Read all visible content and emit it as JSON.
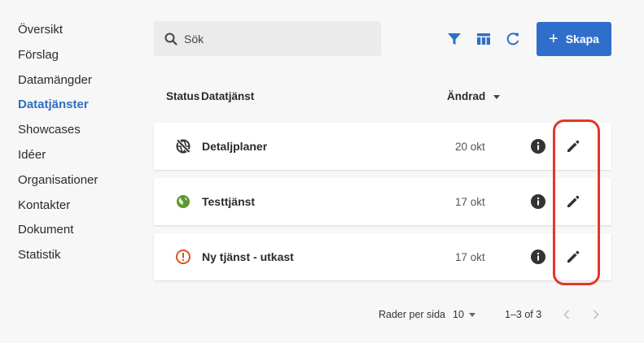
{
  "sidebar": {
    "items": [
      {
        "label": "Översikt"
      },
      {
        "label": "Förslag"
      },
      {
        "label": "Datamängder"
      },
      {
        "label": "Datatjänster",
        "active": true
      },
      {
        "label": "Showcases"
      },
      {
        "label": "Idéer"
      },
      {
        "label": "Organisationer"
      },
      {
        "label": "Kontakter"
      },
      {
        "label": "Dokument"
      },
      {
        "label": "Statistik"
      }
    ]
  },
  "search": {
    "placeholder": "Sök",
    "value": ""
  },
  "toolbar": {
    "filter_icon": "filter-icon",
    "columns_icon": "table-columns-icon",
    "refresh_icon": "refresh-icon",
    "create_label": "Skapa"
  },
  "table": {
    "headers": {
      "status": "Status",
      "service": "Datatjänst",
      "modified": "Ändrad"
    },
    "rows": [
      {
        "status_icon": "globe-off-icon",
        "name": "Detaljplaner",
        "date": "20 okt"
      },
      {
        "status_icon": "globe-icon",
        "name": "Testtjänst",
        "date": "17 okt"
      },
      {
        "status_icon": "alert-icon",
        "name": "Ny tjänst - utkast",
        "date": "17 okt"
      }
    ]
  },
  "pagination": {
    "rows_per_page_label": "Rader per sida",
    "rows_per_page_value": "10",
    "range": "1–3 of 3"
  },
  "colors": {
    "accent": "#2f6fcb",
    "active_nav": "#2f6fbe",
    "published": "#5a9a2e",
    "draft": "#d9541e",
    "highlight": "#e5362a"
  }
}
